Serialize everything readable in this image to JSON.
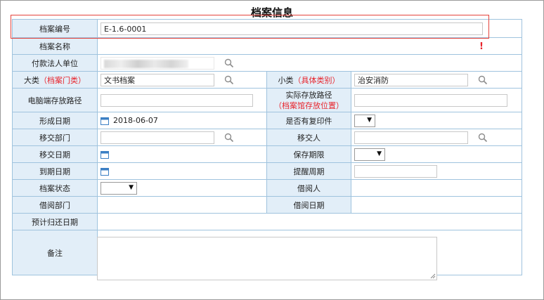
{
  "title": "档案信息",
  "fields": {
    "archive_no": {
      "label": "档案编号",
      "value": "E-1.6-0001"
    },
    "archive_name": {
      "label": "档案名称",
      "value": ""
    },
    "payer": {
      "label": "付款法人单位"
    },
    "major": {
      "label": "大类",
      "hint": "（档案门类）",
      "value": "文书档案"
    },
    "minor": {
      "label": "小类",
      "hint": "（具体类别）",
      "value": "治安消防"
    },
    "pc_path": {
      "label": "电脑端存放路径",
      "value": ""
    },
    "real_path": {
      "label": "实际存放路径",
      "hint": "（档案馆存放位置）",
      "value": ""
    },
    "form_date": {
      "label": "形成日期",
      "value": "2018-06-07"
    },
    "has_copy": {
      "label": "是否有复印件",
      "value": ""
    },
    "dept": {
      "label": "移交部门",
      "value": ""
    },
    "person": {
      "label": "移交人",
      "value": ""
    },
    "transfer_date": {
      "label": "移交日期",
      "value": ""
    },
    "retention": {
      "label": "保存期限",
      "value": ""
    },
    "due_date": {
      "label": "到期日期",
      "value": ""
    },
    "remind": {
      "label": "提醒周期",
      "value": ""
    },
    "status": {
      "label": "档案状态",
      "value": ""
    },
    "borrower": {
      "label": "借阅人",
      "value": ""
    },
    "borrow_dept": {
      "label": "借阅部门",
      "value": ""
    },
    "borrow_date": {
      "label": "借阅日期",
      "value": ""
    },
    "expected_return": {
      "label": "预计归还日期",
      "value": ""
    },
    "remark": {
      "label": "备注",
      "value": ""
    }
  },
  "required_mark": "!",
  "colors": {
    "label_bg": "#e2eef8",
    "border": "#9fc3de",
    "hint_red": "#e8242c",
    "highlight": "#e4433b"
  }
}
